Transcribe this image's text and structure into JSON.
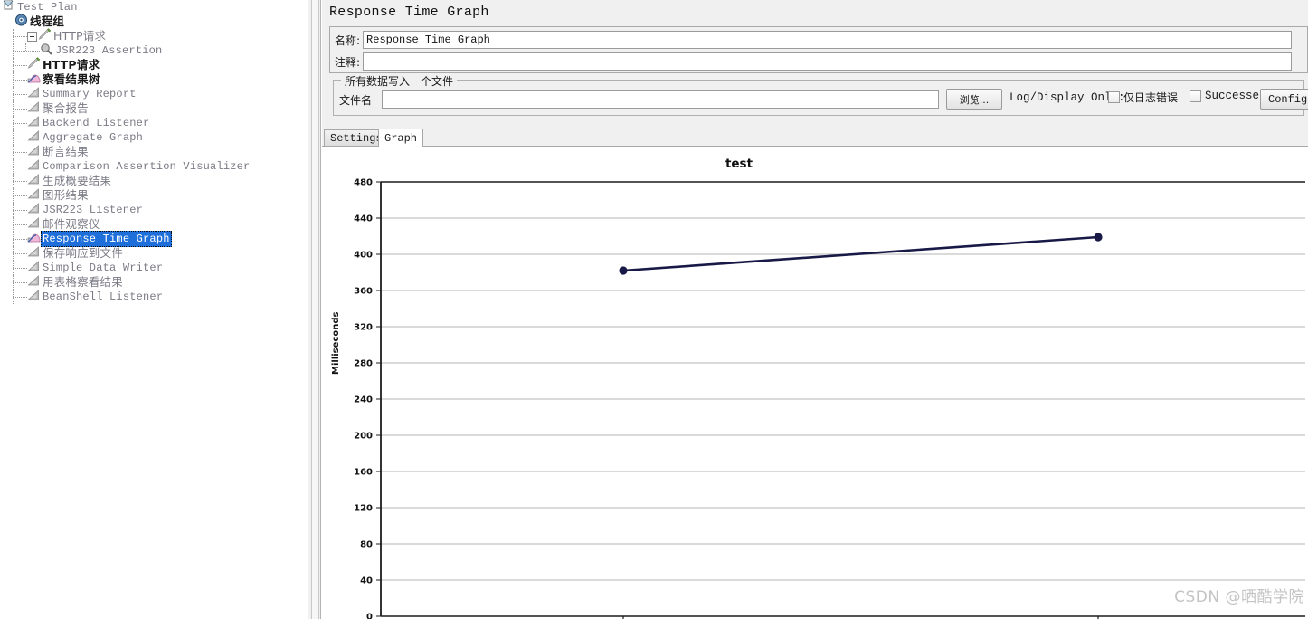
{
  "tree": {
    "items": [
      {
        "label": "Test Plan",
        "depth": 0,
        "icon": "test-plan-icon",
        "style": "mono",
        "selected": false,
        "expander": false,
        "bold": false
      },
      {
        "label": "线程组",
        "depth": 1,
        "icon": "thread-group-icon",
        "style": "cjk",
        "selected": false,
        "expander": false,
        "bold": true
      },
      {
        "label": "HTTP请求",
        "depth": 2,
        "icon": "http-request-icon",
        "style": "cjk",
        "selected": false,
        "expander": true,
        "bold": false
      },
      {
        "label": "JSR223 Assertion",
        "depth": 3,
        "icon": "assertion-icon",
        "style": "mono",
        "selected": false,
        "expander": false,
        "bold": false
      },
      {
        "label": "HTTP请求",
        "depth": 2,
        "icon": "http-request-icon",
        "style": "cjk",
        "selected": false,
        "expander": false,
        "bold": true
      },
      {
        "label": "察看结果树",
        "depth": 2,
        "icon": "view-results-tree-icon",
        "style": "cjk",
        "selected": false,
        "expander": false,
        "bold": true
      },
      {
        "label": "Summary Report",
        "depth": 2,
        "icon": "listener-icon",
        "style": "mono",
        "selected": false,
        "expander": false,
        "bold": false
      },
      {
        "label": "聚合报告",
        "depth": 2,
        "icon": "listener-icon",
        "style": "cjk",
        "selected": false,
        "expander": false,
        "bold": false
      },
      {
        "label": "Backend Listener",
        "depth": 2,
        "icon": "listener-icon",
        "style": "mono",
        "selected": false,
        "expander": false,
        "bold": false
      },
      {
        "label": "Aggregate Graph",
        "depth": 2,
        "icon": "listener-icon",
        "style": "mono",
        "selected": false,
        "expander": false,
        "bold": false
      },
      {
        "label": "断言结果",
        "depth": 2,
        "icon": "listener-icon",
        "style": "cjk",
        "selected": false,
        "expander": false,
        "bold": false
      },
      {
        "label": "Comparison Assertion Visualizer",
        "depth": 2,
        "icon": "listener-icon",
        "style": "mono",
        "selected": false,
        "expander": false,
        "bold": false
      },
      {
        "label": "生成概要结果",
        "depth": 2,
        "icon": "listener-icon",
        "style": "cjk",
        "selected": false,
        "expander": false,
        "bold": false
      },
      {
        "label": "图形结果",
        "depth": 2,
        "icon": "listener-icon",
        "style": "cjk",
        "selected": false,
        "expander": false,
        "bold": false
      },
      {
        "label": "JSR223 Listener",
        "depth": 2,
        "icon": "listener-icon",
        "style": "mono",
        "selected": false,
        "expander": false,
        "bold": false
      },
      {
        "label": "邮件观察仪",
        "depth": 2,
        "icon": "listener-icon",
        "style": "cjk",
        "selected": false,
        "expander": false,
        "bold": false
      },
      {
        "label": "Response Time Graph",
        "depth": 2,
        "icon": "response-time-graph-icon",
        "style": "mono",
        "selected": true,
        "expander": false,
        "bold": false
      },
      {
        "label": "保存响应到文件",
        "depth": 2,
        "icon": "listener-icon",
        "style": "cjk",
        "selected": false,
        "expander": false,
        "bold": false
      },
      {
        "label": "Simple Data Writer",
        "depth": 2,
        "icon": "listener-icon",
        "style": "mono",
        "selected": false,
        "expander": false,
        "bold": false
      },
      {
        "label": "用表格察看结果",
        "depth": 2,
        "icon": "listener-icon",
        "style": "cjk",
        "selected": false,
        "expander": false,
        "bold": false
      },
      {
        "label": "BeanShell Listener",
        "depth": 2,
        "icon": "listener-icon",
        "style": "mono",
        "selected": false,
        "expander": false,
        "bold": false
      }
    ],
    "selection_bg": "#1e6fd9",
    "text_color": "#7a7a85"
  },
  "panel": {
    "title": "Response Time Graph",
    "name_label": "名称:",
    "name_value": "Response Time Graph",
    "comment_label": "注释:",
    "comment_value": "",
    "file_group_legend": "所有数据写入一个文件",
    "filename_label": "文件名",
    "filename_value": "",
    "browse_button": "浏览...",
    "log_display_label": "Log/Display Only:",
    "errors_checkbox": "仅日志错误",
    "errors_checked": false,
    "successes_checkbox": "Successes",
    "successes_checked": false,
    "configure_button": "Configur"
  },
  "tabs": {
    "items": [
      {
        "label": "Settings",
        "active": false
      },
      {
        "label": "Graph",
        "active": true
      }
    ]
  },
  "chart_data": {
    "type": "line",
    "title": "test",
    "xlabel": "",
    "ylabel": "Milliseconds",
    "ylim": [
      0,
      480
    ],
    "ytick_step": 40,
    "ytick_labels": [
      "480",
      "440",
      "400",
      "360",
      "320",
      "280",
      "240",
      "200",
      "160",
      "120",
      "80",
      "40",
      "0"
    ],
    "grid": true,
    "legend": "none",
    "series": [
      {
        "name": "test",
        "color": "#191947",
        "marker": "circle",
        "x": [
          1,
          2
        ],
        "values": [
          382,
          419
        ]
      }
    ]
  },
  "watermark": "CSDN @晒酷学院"
}
